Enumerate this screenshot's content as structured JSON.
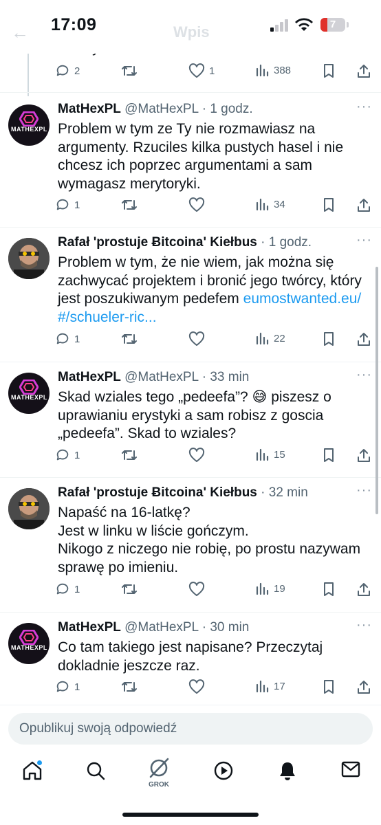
{
  "status_bar": {
    "time": "17:09",
    "battery": "7"
  },
  "header": {
    "title": "Wpis"
  },
  "partial_tweet": {
    "text": "maksymalisci Bitcoina.",
    "replies": "2",
    "likes": "1",
    "views": "388"
  },
  "tweets": [
    {
      "name": "MatHexPL",
      "handle": "@MatHexPL",
      "dot": "·",
      "time": "1 godz.",
      "lines": [
        "Problem w tym ze Ty nie rozmawiasz na",
        "argumenty. Rzuciles kilka pustych hasel i nie",
        "chcesz ich poprzec argumentami a sam",
        "wymagasz merytoryki."
      ],
      "replies": "1",
      "views": "34"
    },
    {
      "name": "Rafał 'prostuje Ƀitcoina' Kiełbus",
      "dot": "·",
      "time": "1 godz.",
      "lines": [
        "Problem w tym, że nie wiem, jak można się",
        "zachwycać projektem i bronić jego twórcy, który"
      ],
      "line3_prefix": "jest poszukiwanym pedefem ",
      "link1": "eumostwanted.eu/",
      "link2": "#/schueler-ric...",
      "replies": "1",
      "views": "22"
    },
    {
      "name": "MatHexPL",
      "handle": "@MatHexPL",
      "dot": "·",
      "time": "33 min",
      "line1_text": "Skad wziales tego „pedeefa”? ",
      "emoji": "😅",
      "line1_after": " piszesz o",
      "lines": [
        "uprawianiu erystyki a sam robisz z goscia",
        "„pedeefa”. Skad to wziales?"
      ],
      "replies": "1",
      "views": "15"
    },
    {
      "name": "Rafał 'prostuje Ƀitcoina' Kiełbus",
      "dot": "·",
      "time": "32 min",
      "lines": [
        "Napaść na 16-latkę?",
        "Jest w linku w liście gończym.",
        "Nikogo z niczego nie robię, po prostu nazywam",
        "sprawę po imieniu."
      ],
      "replies": "1",
      "views": "19"
    },
    {
      "name": "MatHexPL",
      "handle": "@MatHexPL",
      "dot": "·",
      "time": "30 min",
      "lines": [
        "Co tam takiego jest napisane? Przeczytaj",
        "dokladnie jeszcze raz."
      ],
      "replies": "1",
      "views": "17"
    }
  ],
  "avatar_text": {
    "mathex": "MATHEXPL"
  },
  "composer": {
    "placeholder": "Opublikuj swoją odpowiedź"
  },
  "tabbar": {
    "grok_label": "GROK"
  },
  "colors": {
    "link": "#1d9bf0",
    "muted": "#536471",
    "text": "#0f1419"
  },
  "icons": [
    "back-arrow-icon",
    "signal-icon",
    "wifi-icon",
    "battery-icon",
    "reply-icon",
    "retweet-icon",
    "like-icon",
    "views-icon",
    "bookmark-icon",
    "share-icon",
    "more-icon",
    "home-icon",
    "search-icon",
    "grok-icon",
    "play-icon",
    "bell-icon",
    "mail-icon"
  ]
}
